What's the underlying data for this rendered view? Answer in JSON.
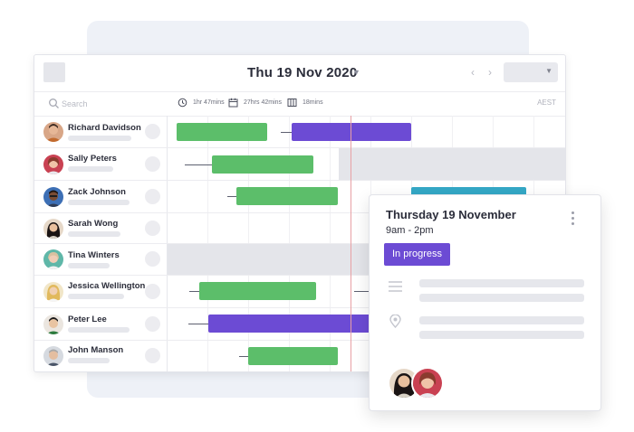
{
  "header": {
    "date_title": "Thu 19 Nov 2020"
  },
  "search": {
    "placeholder": "Search"
  },
  "stats": [
    {
      "icon": "clock-icon",
      "label": "1hr 47mins"
    },
    {
      "icon": "calendar-icon",
      "label": "27hrs 42mins"
    },
    {
      "icon": "columns-icon",
      "label": "18mins"
    }
  ],
  "timezone": "AEST",
  "colors": {
    "green": "#5cbe6a",
    "purple": "#6c4bd4",
    "teal": "#34a8c6",
    "now_line": "#e8a0a4",
    "shaded": "#e4e5ea"
  },
  "employees": [
    {
      "name": "Richard Davidson"
    },
    {
      "name": "Sally Peters"
    },
    {
      "name": "Zack Johnson"
    },
    {
      "name": "Sarah Wong"
    },
    {
      "name": "Tina Winters"
    },
    {
      "name": "Jessica Wellington"
    },
    {
      "name": "Peter Lee"
    },
    {
      "name": "John Manson"
    }
  ],
  "detail_card": {
    "title": "Thursday 19 November",
    "time": "9am - 2pm",
    "status": "In progress"
  }
}
